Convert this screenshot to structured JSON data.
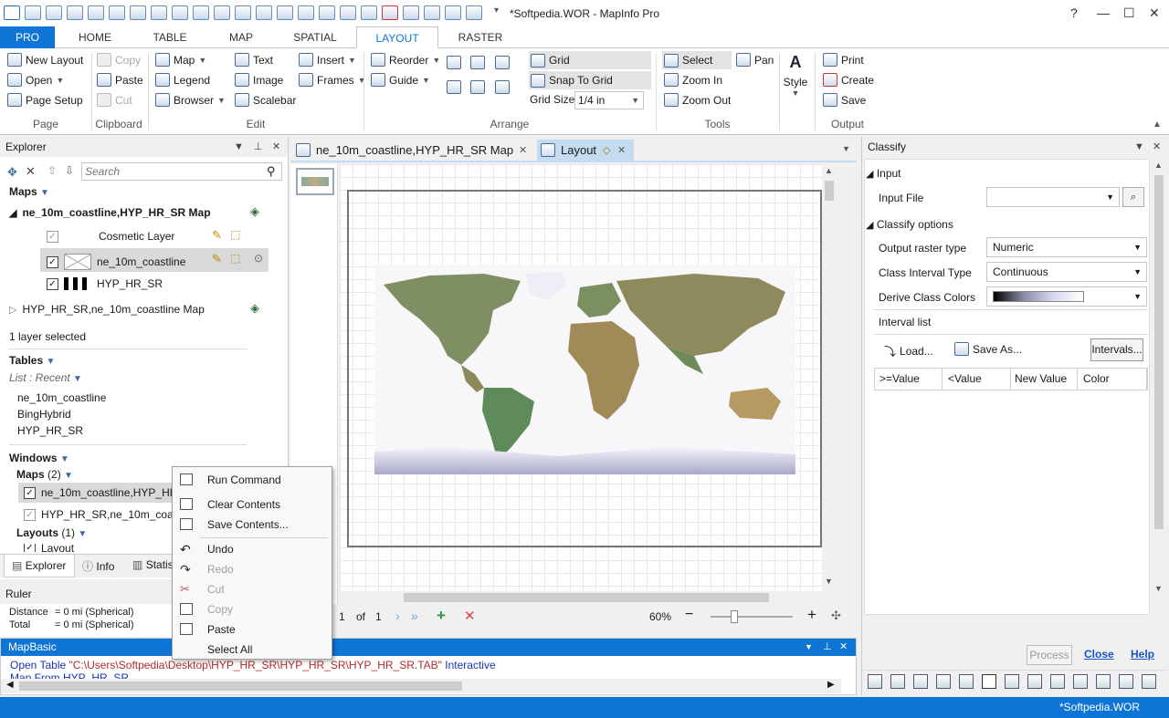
{
  "window": {
    "title": "*Softpedia.WOR - MapInfo Pro"
  },
  "ribbon_tabs": [
    "PRO",
    "HOME",
    "TABLE",
    "MAP",
    "SPATIAL",
    "LAYOUT",
    "RASTER"
  ],
  "ribbon": {
    "page": {
      "new_layout": "New Layout",
      "open": "Open",
      "page_setup": "Page Setup",
      "label": "Page"
    },
    "clipboard": {
      "copy": "Copy",
      "paste": "Paste",
      "cut": "Cut",
      "label": "Clipboard"
    },
    "edit": {
      "map": "Map",
      "legend": "Legend",
      "browser": "Browser",
      "text": "Text",
      "image": "Image",
      "scalebar": "Scalebar",
      "insert": "Insert",
      "frames": "Frames",
      "label": "Edit"
    },
    "arrange": {
      "reorder": "Reorder",
      "guide": "Guide",
      "grid": "Grid",
      "snap": "Snap To Grid",
      "grid_size_label": "Grid Size",
      "grid_size_value": "1/4 in",
      "label": "Arrange"
    },
    "tools": {
      "select": "Select",
      "pan": "Pan",
      "zoom_in": "Zoom In",
      "zoom_out": "Zoom Out",
      "style": "Style",
      "label": "Tools"
    },
    "output": {
      "print": "Print",
      "create": "Create",
      "save": "Save",
      "label": "Output"
    }
  },
  "explorer": {
    "title": "Explorer",
    "search_placeholder": "Search",
    "maps_header": "Maps",
    "map1": "ne_10m_coastline,HYP_HR_SR Map",
    "layers": [
      "Cosmetic Layer",
      "ne_10m_coastline",
      "HYP_HR_SR"
    ],
    "map2": "HYP_HR_SR,ne_10m_coastline Map",
    "selection_status": "1 layer selected",
    "tables_header": "Tables",
    "list_recent": "List : Recent",
    "tables": [
      "ne_10m_coastline",
      "BingHybrid",
      "HYP_HR_SR"
    ],
    "windows_header": "Windows",
    "maps_count_label": "Maps",
    "maps_count": "(2)",
    "window_maps": [
      "ne_10m_coastline,HYP_HR_SR Map",
      "HYP_HR_SR,ne_10m_coastline Map"
    ],
    "layouts_label": "Layouts",
    "layouts_count": "(1)",
    "layout_item": "Layout",
    "bottom_tabs": [
      "Explorer",
      "Info",
      "Statistics"
    ]
  },
  "ruler": {
    "title": "Ruler",
    "distance_label": "Distance",
    "distance_value": "= 0 mi (Spherical)",
    "total_label": "Total",
    "total_value": "= 0 mi (Spherical)"
  },
  "context_menu": {
    "items": [
      "Run Command",
      "Clear Contents",
      "Save Contents...",
      "Undo",
      "Redo",
      "Cut",
      "Copy",
      "Paste",
      "Select All"
    ]
  },
  "doc_tabs": {
    "map_tab": "ne_10m_coastline,HYP_HR_SR Map",
    "layout_tab": "Layout"
  },
  "layout_footer": {
    "page_current": "1",
    "of_label": "of",
    "page_total": "1",
    "zoom": "60%"
  },
  "mapbasic": {
    "title": "MapBasic",
    "line1_cmd": "Open Table ",
    "line1_path": "\"C:\\Users\\Softpedia\\Desktop\\HYP_HR_SR\\HYP_HR_SR\\HYP_HR_SR.TAB\"",
    "line1_tail": " Interactive",
    "line2": "Map From HYP_HR_SR"
  },
  "classify": {
    "title": "Classify",
    "input_section": "Input",
    "input_file_label": "Input File",
    "input_file_value": "",
    "options_section": "Classify options",
    "output_type_label": "Output raster type",
    "output_type_value": "Numeric",
    "interval_type_label": "Class Interval Type",
    "interval_type_value": "Continuous",
    "derive_colors_label": "Derive Class Colors",
    "interval_list_label": "Interval list",
    "load_button": "Load...",
    "save_as_button": "Save As...",
    "intervals_button": "Intervals...",
    "table_headers": [
      ">=Value",
      "<Value",
      "New Value",
      "Color"
    ],
    "process_button": "Process",
    "close_link": "Close",
    "help_link": "Help"
  },
  "status_bar": {
    "workspace": "*Softpedia.WOR"
  },
  "colors": {
    "accent": "#0e74d5",
    "status_bar": "#0e74d5",
    "mapbasic_header": "#0e74d5"
  }
}
